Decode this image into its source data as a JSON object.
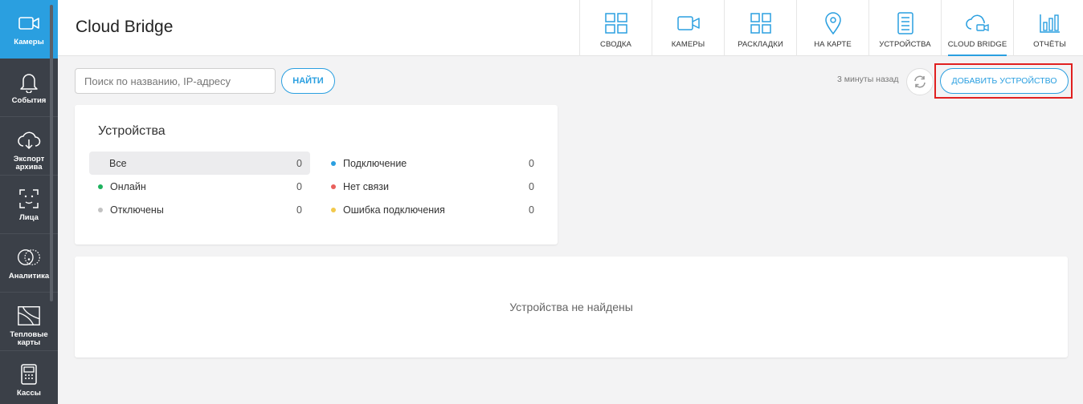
{
  "sidebar": {
    "items": [
      {
        "label": "Камеры",
        "icon": "camera-icon"
      },
      {
        "label": "События",
        "icon": "bell-icon"
      },
      {
        "label": "Экспорт архива",
        "icon": "cloud-download-icon"
      },
      {
        "label": "Лица",
        "icon": "face-icon"
      },
      {
        "label": "Аналитика",
        "icon": "analytics-icon"
      },
      {
        "label": "Тепловые карты",
        "icon": "heatmap-icon"
      },
      {
        "label": "Кассы",
        "icon": "cash-register-icon"
      }
    ]
  },
  "header": {
    "title": "Cloud Bridge",
    "nav": [
      {
        "label": "СВОДКА",
        "icon": "grid-icon"
      },
      {
        "label": "КАМЕРЫ",
        "icon": "camera-icon"
      },
      {
        "label": "РАСКЛАДКИ",
        "icon": "layout-icon"
      },
      {
        "label": "НА КАРТЕ",
        "icon": "map-pin-icon"
      },
      {
        "label": "УСТРОЙСТВА",
        "icon": "device-icon"
      },
      {
        "label": "CLOUD BRIDGE",
        "icon": "cloud-camera-icon"
      },
      {
        "label": "ОТЧЁТЫ",
        "icon": "bar-chart-icon"
      }
    ]
  },
  "toolbar": {
    "search_placeholder": "Поиск по названию, IP-адресу",
    "search_value": "",
    "find_label": "НАЙТИ",
    "updated": "3 минуты назад",
    "add_label": "ДОБАВИТЬ УСТРОЙСТВО"
  },
  "stats": {
    "title": "Устройства",
    "left": [
      {
        "label": "Все",
        "count": "0",
        "color": ""
      },
      {
        "label": "Онлайн",
        "count": "0",
        "color": "#1db25e"
      },
      {
        "label": "Отключены",
        "count": "0",
        "color": "#c2c2c2"
      }
    ],
    "right": [
      {
        "label": "Подключение",
        "count": "0",
        "color": "#2a9fe0"
      },
      {
        "label": "Нет связи",
        "count": "0",
        "color": "#e9605c"
      },
      {
        "label": "Ошибка подключения",
        "count": "0",
        "color": "#f2c94c"
      }
    ]
  },
  "empty": {
    "message": "Устройства не найдены"
  },
  "colors": {
    "accent": "#2a9fe0",
    "sidebar": "#3b4048",
    "highlight": "#e02020"
  }
}
